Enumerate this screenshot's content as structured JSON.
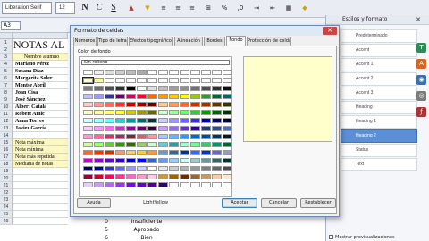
{
  "toolbar": {
    "font_name": "Liberation Serif",
    "font_size": "12",
    "bold": "N",
    "italic": "C",
    "underline": "S"
  },
  "formula": {
    "cell_ref": "A3"
  },
  "sheet": {
    "row_numbers": [
      "1",
      "2",
      "3",
      "4",
      "5",
      "6",
      "7",
      "8",
      "9",
      "10",
      "11",
      "12",
      "13",
      "14",
      "15",
      "16",
      "17",
      "18",
      "19",
      "20",
      "21",
      "22",
      "23",
      "24",
      "25",
      "26"
    ],
    "title": "NOTAS AL",
    "header_cell": "Nombre alumno",
    "students": [
      "Mariano Pérez",
      "Susana Díaz",
      "Margarita Soler",
      "Montse Abril",
      "Joan Cisa",
      "José Sánchez",
      "Albert Català",
      "Robert Amic",
      "Anna Torres",
      "Javier García"
    ],
    "stats": [
      "Nota máxima",
      "Nota mínima",
      "Nota más repetida",
      "Mediana de notas"
    ],
    "bottom_rows": [
      {
        "num": "0",
        "txt": "Insuficiente"
      },
      {
        "num": "5",
        "txt": "Aprobado"
      },
      {
        "num": "6",
        "txt": "Bien"
      }
    ]
  },
  "dialog": {
    "title": "Formato de celdas",
    "close_glyph": "✕",
    "tabs": [
      "Números",
      "Tipo de letra",
      "Efectos tipográficos",
      "Alineación",
      "Bordes",
      "Fondo",
      "Protección de celda"
    ],
    "active_tab": "Fondo",
    "color_group_label": "Color de fondo",
    "no_fill_label": "Sin relleno",
    "selected_color_name": "LightYellow",
    "preview_color": "#ffffcc",
    "buttons": {
      "help": "Ayuda",
      "ok": "Aceptar",
      "cancel": "Cancelar",
      "reset": "Restablecer"
    }
  },
  "palette": [
    [
      "#ffffff",
      "#eeeeee",
      "#dddddd",
      "#cccccc",
      "#bbbbbb",
      "#aaaaaa",
      "#ffffff",
      "#ffffff",
      "#ffffff",
      "#ffffff",
      "#ffffff",
      "#ffffff",
      "#ffffff",
      "#ffffff"
    ],
    [
      "#ffffcc",
      "#ffff99",
      "#ffffff",
      "#ffffff",
      "#ffffff",
      "#ffffff",
      "#ffffff",
      "#ffffff",
      "#ffffff",
      "#ffffff",
      "#ffffff",
      "#ffffff",
      "#ffffff",
      "#ffffff"
    ],
    [
      "#808080",
      "#707070",
      "#505050",
      "#303030",
      "#000000",
      "#ffffff",
      "#e0e0e0",
      "#c0c0c0",
      "#a0a0a0",
      "#909090",
      "#707070",
      "#505050",
      "#303030",
      "#101010"
    ],
    [
      "#c0c0ff",
      "#9999ff",
      "#333399",
      "#660066",
      "#cc0066",
      "#ff0033",
      "#ff6600",
      "#ff9900",
      "#ffcc00",
      "#ffff00",
      "#99cc00",
      "#339933",
      "#006633",
      "#006666"
    ],
    [
      "#ffcccc",
      "#ff9999",
      "#ff6666",
      "#ff3333",
      "#cc0000",
      "#990000",
      "#660000",
      "#ffcc99",
      "#ff9966",
      "#ff6633",
      "#cc3300",
      "#993300",
      "#663300",
      "#333300"
    ],
    [
      "#ffffcc",
      "#ffff99",
      "#ffff66",
      "#ffff33",
      "#cccc00",
      "#999900",
      "#666600",
      "#ccffcc",
      "#99ff99",
      "#66ff66",
      "#33cc33",
      "#009900",
      "#006600",
      "#003300"
    ],
    [
      "#ccffff",
      "#99ffff",
      "#66ffff",
      "#33cccc",
      "#009999",
      "#006666",
      "#003333",
      "#ccccff",
      "#9999ff",
      "#6666ff",
      "#3333cc",
      "#000099",
      "#000066",
      "#000033"
    ],
    [
      "#ffccff",
      "#ff99ff",
      "#ff66ff",
      "#cc33cc",
      "#990099",
      "#660066",
      "#330033",
      "#cc99ff",
      "#9966ff",
      "#6633cc",
      "#330099",
      "#1f3b73",
      "#2e4b8c",
      "#4f6fbf"
    ],
    [
      "#ff99cc",
      "#ff6699",
      "#cc3366",
      "#993366",
      "#663333",
      "#cc6666",
      "#ff9999",
      "#99ccff",
      "#66b3ff",
      "#3399ff",
      "#0066cc",
      "#004c99",
      "#003366",
      "#001933"
    ],
    [
      "#ccff99",
      "#99ff66",
      "#66cc33",
      "#339900",
      "#336600",
      "#99cc66",
      "#ccffcc",
      "#66cccc",
      "#339999",
      "#99ffcc",
      "#66ff99",
      "#33cc66",
      "#009966",
      "#006633"
    ],
    [
      "#ff6633",
      "#ff3300",
      "#cc3300",
      "#ff9966",
      "#ffcc66",
      "#ffcc33",
      "#ff9933",
      "#6699cc",
      "#336699",
      "#003399",
      "#3366ff",
      "#0033cc",
      "#6666cc",
      "#9999cc"
    ],
    [
      "#cc00cc",
      "#9900cc",
      "#6600cc",
      "#3300cc",
      "#0000cc",
      "#0000ff",
      "#3366cc",
      "#6699ff",
      "#99ccff",
      "#ccffff",
      "#99cccc",
      "#669999",
      "#336666",
      "#003333"
    ],
    [
      "#000066",
      "#000099",
      "#3333cc",
      "#6666ff",
      "#9999ff",
      "#ccccff",
      "#ffffff",
      "#e6e6e6",
      "#cccccc",
      "#b3b3b3",
      "#999999",
      "#808080",
      "#666666",
      "#4d4d4d"
    ],
    [
      "#990033",
      "#cc0033",
      "#ff0066",
      "#ff3399",
      "#ff66cc",
      "#ff99cc",
      "#ffcce6",
      "#cc9933",
      "#996600",
      "#663300",
      "#996633",
      "#cc9966",
      "#ffcc99",
      "#ffe6cc"
    ],
    [
      "#e6ccff",
      "#cc99ff",
      "#b266ff",
      "#9933ff",
      "#7f00ff",
      "#6600cc",
      "#4c0099",
      "#330066",
      "#ffffff",
      "#ffffff",
      "#ffffff",
      "#ffffff",
      "#ffffff",
      "#ffffff"
    ]
  ],
  "sidebar": {
    "title": "Estilos y formato",
    "close_glyph": "✕",
    "items": [
      "Predeterminado",
      "Accent",
      "Accent 1",
      "Accent 2",
      "Accent 3",
      "Heading",
      "Heading 1",
      "Heading 2",
      "Status",
      "Text"
    ],
    "selected_index": 7,
    "show_previews_label": "Mostrar previsualizaciones"
  },
  "colors": {
    "toolbar_bg": "#e9edf3",
    "sheet_bg": "#ffffff",
    "selection_blue": "#5c8fd6",
    "dialog_bg": "#f0f0f0",
    "close_red": "#c9473f"
  }
}
